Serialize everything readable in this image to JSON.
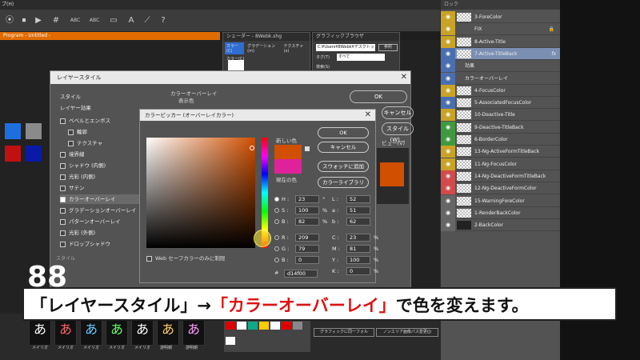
{
  "top": {
    "menu_fragment": "プ(H)",
    "program_tab": "Program - Untitled -",
    "tool_labels": [
      "#",
      "ABC",
      "ABC"
    ]
  },
  "bg_windows": {
    "shader": "シェーダー - 8Webk.shg",
    "shader_tabs": [
      "カラー(C)",
      "グラデーション(m)",
      "テクスチャ(x)"
    ],
    "shader_sub": "カラー(C)",
    "graphic": "グラフィックブラウザ",
    "graphic_path": "C:¥Users¥8Webk¥デスクトップ",
    "graphic_btn": "参照",
    "tag_label": "タグ(T)",
    "tag_value": "すべて",
    "search_label": "検索(S)"
  },
  "layer_style": {
    "title": "レイヤースタイル",
    "style_header": "スタイル",
    "effects_header": "レイヤー効果",
    "effects": [
      {
        "label": "ベベルとエンボス",
        "checked": false
      },
      {
        "label": "輪郭",
        "checked": false
      },
      {
        "label": "テクスチャ",
        "checked": false
      },
      {
        "label": "境界線",
        "checked": false
      },
      {
        "label": "シャドウ (内側)",
        "checked": false
      },
      {
        "label": "光彩 (内側)",
        "checked": false
      },
      {
        "label": "サテン",
        "checked": false
      },
      {
        "label": "カラーオーバーレイ",
        "checked": true
      },
      {
        "label": "グラデーションオーバーレイ",
        "checked": false
      },
      {
        "label": "パターンオーバーレイ",
        "checked": false
      },
      {
        "label": "光彩 (外側)",
        "checked": false
      },
      {
        "label": "ドロップシャドウ",
        "checked": false
      }
    ],
    "panel_title": "カラーオーバーレイ",
    "panel_sub": "表示色",
    "btn_ok": "OK",
    "btn_cancel": "キャンセル",
    "btn_style": "スタイル(W)...",
    "btn_preview": "ビュー(V)",
    "overlay_color": "#d14f00"
  },
  "picker": {
    "title": "カラーピッカー (オーバーレイカラー)",
    "new_label": "新しい色",
    "current_label": "現在の色",
    "new_color": "#d14f00",
    "current_color": "#e0229a",
    "buttons": {
      "ok": "OK",
      "cancel": "キャンセル",
      "add_swatch": "スウォッチに追加",
      "library": "カラーライブラリ"
    },
    "web_only": "Web セーフカラーのみに制限",
    "fields_left": [
      {
        "label": "H :",
        "value": "23",
        "unit": "°",
        "selected": true
      },
      {
        "label": "S :",
        "value": "100",
        "unit": "%"
      },
      {
        "label": "B :",
        "value": "82",
        "unit": "%"
      },
      {
        "label": "R :",
        "value": "209",
        "unit": ""
      },
      {
        "label": "G :",
        "value": "79",
        "unit": ""
      },
      {
        "label": "B :",
        "value": "0",
        "unit": ""
      }
    ],
    "fields_right": [
      {
        "label": "L :",
        "value": "52",
        "unit": ""
      },
      {
        "label": "a :",
        "value": "51",
        "unit": ""
      },
      {
        "label": "b :",
        "value": "62",
        "unit": ""
      },
      {
        "label": "C :",
        "value": "23",
        "unit": "%"
      },
      {
        "label": "M :",
        "value": "81",
        "unit": "%"
      },
      {
        "label": "Y :",
        "value": "100",
        "unit": "%"
      },
      {
        "label": "K :",
        "value": "0",
        "unit": "%"
      }
    ],
    "hex_label": "#",
    "hex_value": "d14f00"
  },
  "layers": {
    "head": "ロック",
    "items": [
      {
        "name": "3-ForeColor",
        "eye": "#c9a227",
        "thumb": "check"
      },
      {
        "name": "FIX",
        "eye": "#c9a227",
        "thumb": "none",
        "lock": true
      },
      {
        "name": "8-Active-Title",
        "eye": "#c9a227",
        "thumb": "check"
      },
      {
        "name": "7-Active-TitleBack",
        "eye": "#4a6fb0",
        "thumb": "check",
        "fx": "fx",
        "selected": true
      },
      {
        "name": "効果",
        "eye": "#4a6fb0",
        "thumb": "none",
        "indent": true
      },
      {
        "name": "カラーオーバーレイ",
        "eye": "#4a6fb0",
        "thumb": "none",
        "indent": true
      },
      {
        "name": "4-FocusColor",
        "eye": "#c9a227",
        "thumb": "check"
      },
      {
        "name": "5-AssociatedFocusColor",
        "eye": "#4a6fb0",
        "thumb": "check"
      },
      {
        "name": "10-Deactive-Title",
        "eye": "#c9a227",
        "thumb": "check"
      },
      {
        "name": "9-Deactive-TitleBack",
        "eye": "#3f9a3f",
        "thumb": "check"
      },
      {
        "name": "6-BorderColor",
        "eye": "#3f9a3f",
        "thumb": "check"
      },
      {
        "name": "13-Ng-ActiveFormTitleBack",
        "eye": "#c9a227",
        "thumb": "check"
      },
      {
        "name": "11-Ng-FocusColor",
        "eye": "#c9a227",
        "thumb": "check"
      },
      {
        "name": "14-Ng-DeactiveFormTitleBack",
        "eye": "#d24a4a",
        "thumb": "check"
      },
      {
        "name": "12-Ng-DeactiveFormColor",
        "eye": "#d24a4a",
        "thumb": "check"
      },
      {
        "name": "15-WarningForeColor",
        "eye": "#666666",
        "thumb": "check"
      },
      {
        "name": "1-RenderBackColor",
        "eye": "#666666",
        "thumb": "check"
      },
      {
        "name": "2-BackColor",
        "eye": "#666666",
        "thumb": "dark"
      }
    ]
  },
  "caption": {
    "part1": "「レイヤースタイル」→",
    "part2": "「カラーオーバーレイ」",
    "part3": "で色を変えます。"
  },
  "bottom": {
    "glyph": "あ",
    "labels": [
      "メイリオ",
      "メイリオ",
      "メイリオ",
      "メイリオ",
      "メイリオ",
      "游明朝",
      "游明朝"
    ],
    "buttons": [
      "グラフィックに同一フォル",
      "ノンエリア画像パス変更(j)"
    ],
    "style_label": "スタイル",
    "big_number": "88"
  }
}
